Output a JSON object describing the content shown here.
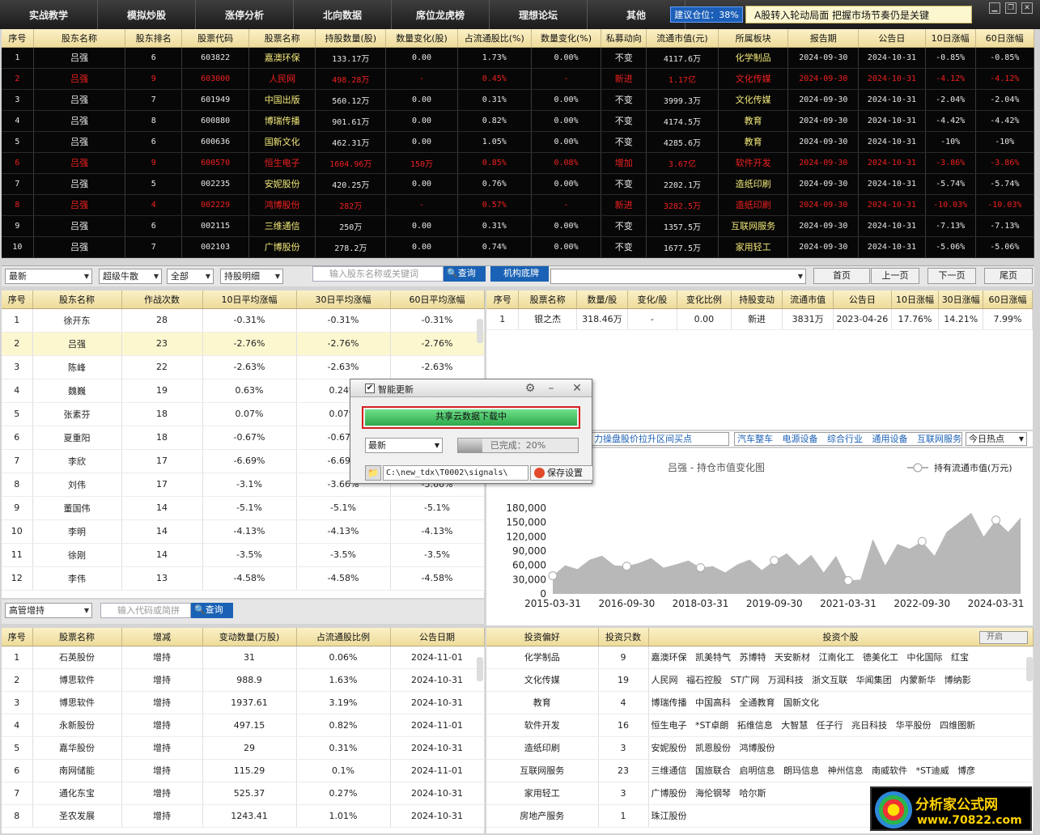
{
  "nav": {
    "items": [
      "实战教学",
      "模拟炒股",
      "涨停分析",
      "北向数据",
      "席位龙虎榜",
      "理想论坛",
      "其他"
    ],
    "advice": "建议仓位：38%",
    "marquee": "A股转入轮动局面 把握市场节奏仍是关键"
  },
  "top_table": {
    "headers": [
      "序号",
      "股东名称",
      "股东排名",
      "股票代码",
      "股票名称",
      "持股数量(股)",
      "数量变化(股)",
      "占流通股比(%)",
      "数量变化(%)",
      "私募动向",
      "流通市值(元)",
      "所属板块",
      "报告期",
      "公告日",
      "10日涨幅",
      "60日涨幅"
    ],
    "rows": [
      [
        "1",
        "吕强",
        "6",
        "603822",
        "嘉澳环保",
        "133.17万",
        "0.00",
        "1.73%",
        "0.00%",
        "不变",
        "4117.6万",
        "化学制品",
        "2024-09-30",
        "2024-10-31",
        "-0.85%",
        "-0.85%"
      ],
      [
        "2",
        "吕强",
        "9",
        "603000",
        "人民网",
        "498.28万",
        "-",
        "0.45%",
        "-",
        "新进",
        "1.17亿",
        "文化传媒",
        "2024-09-30",
        "2024-10-31",
        "-4.12%",
        "-4.12%"
      ],
      [
        "3",
        "吕强",
        "7",
        "601949",
        "中国出版",
        "560.12万",
        "0.00",
        "0.31%",
        "0.00%",
        "不变",
        "3999.3万",
        "文化传媒",
        "2024-09-30",
        "2024-10-31",
        "-2.04%",
        "-2.04%"
      ],
      [
        "4",
        "吕强",
        "8",
        "600880",
        "博瑞传播",
        "901.61万",
        "0.00",
        "0.82%",
        "0.00%",
        "不变",
        "4174.5万",
        "教育",
        "2024-09-30",
        "2024-10-31",
        "-4.42%",
        "-4.42%"
      ],
      [
        "5",
        "吕强",
        "6",
        "600636",
        "国新文化",
        "462.31万",
        "0.00",
        "1.05%",
        "0.00%",
        "不变",
        "4285.6万",
        "教育",
        "2024-09-30",
        "2024-10-31",
        "-10%",
        "-10%"
      ],
      [
        "6",
        "吕强",
        "9",
        "600570",
        "恒生电子",
        "1604.96万",
        "150万",
        "0.85%",
        "0.08%",
        "增加",
        "3.67亿",
        "软件开发",
        "2024-09-30",
        "2024-10-31",
        "-3.86%",
        "-3.86%"
      ],
      [
        "7",
        "吕强",
        "5",
        "002235",
        "安妮股份",
        "420.25万",
        "0.00",
        "0.76%",
        "0.00%",
        "不变",
        "2202.1万",
        "造纸印刷",
        "2024-09-30",
        "2024-10-31",
        "-5.74%",
        "-5.74%"
      ],
      [
        "8",
        "吕强",
        "4",
        "002229",
        "鸿博股份",
        "282万",
        "-",
        "0.57%",
        "-",
        "新进",
        "3282.5万",
        "造纸印刷",
        "2024-09-30",
        "2024-10-31",
        "-10.03%",
        "-10.03%"
      ],
      [
        "9",
        "吕强",
        "6",
        "002115",
        "三维通信",
        "250万",
        "0.00",
        "0.31%",
        "0.00%",
        "不变",
        "1357.5万",
        "互联网服务",
        "2024-09-30",
        "2024-10-31",
        "-7.13%",
        "-7.13%"
      ],
      [
        "10",
        "吕强",
        "7",
        "002103",
        "广博股份",
        "278.2万",
        "0.00",
        "0.74%",
        "0.00%",
        "不变",
        "1677.5万",
        "家用轻工",
        "2024-09-30",
        "2024-10-31",
        "-5.06%",
        "-5.06%"
      ]
    ],
    "red_rows": [
      1,
      5,
      7
    ]
  },
  "toolbar": {
    "dd1": "最新",
    "dd2": "超级牛散",
    "dd3": "全部",
    "dd4": "持股明细",
    "search_placeholder": "输入股东名称或关键词",
    "query": "查询",
    "inst": "机构底牌",
    "first": "首页",
    "prev": "上一页",
    "next": "下一页",
    "last": "尾页"
  },
  "left_table": {
    "headers": [
      "序号",
      "股东名称",
      "作战次数",
      "10日平均涨幅",
      "30日平均涨幅",
      "60日平均涨幅"
    ],
    "rows": [
      [
        "1",
        "徐开东",
        "28",
        "-0.31%",
        "-0.31%",
        "-0.31%"
      ],
      [
        "2",
        "吕强",
        "23",
        "-2.76%",
        "-2.76%",
        "-2.76%"
      ],
      [
        "3",
        "陈峰",
        "22",
        "-2.63%",
        "-2.63%",
        "-2.63%"
      ],
      [
        "4",
        "魏巍",
        "19",
        "0.63%",
        "0.24%",
        ""
      ],
      [
        "5",
        "张素芬",
        "18",
        "0.07%",
        "0.07%",
        ""
      ],
      [
        "6",
        "夏重阳",
        "18",
        "-0.67%",
        "-0.67%",
        ""
      ],
      [
        "7",
        "李欣",
        "17",
        "-6.69%",
        "-6.69%",
        ""
      ],
      [
        "8",
        "刘伟",
        "17",
        "-3.1%",
        "-3.66%",
        "-3.66%"
      ],
      [
        "9",
        "董国伟",
        "14",
        "-5.1%",
        "-5.1%",
        "-5.1%"
      ],
      [
        "10",
        "李明",
        "14",
        "-4.13%",
        "-4.13%",
        "-4.13%"
      ],
      [
        "11",
        "徐刚",
        "14",
        "-3.5%",
        "-3.5%",
        "-3.5%"
      ],
      [
        "12",
        "李伟",
        "13",
        "-4.58%",
        "-4.58%",
        "-4.58%"
      ]
    ]
  },
  "right_table": {
    "headers": [
      "序号",
      "股票名称",
      "数量/股",
      "变化/股",
      "变化比例",
      "持股变动",
      "流通市值",
      "公告日",
      "10日涨幅",
      "30日涨幅",
      "60日涨幅"
    ],
    "rows": [
      [
        "1",
        "银之杰",
        "318.46万",
        "-",
        "0.00",
        "新进",
        "3831万",
        "2023-04-26",
        "17.76%",
        "14.21%",
        "7.99%"
      ]
    ]
  },
  "dialog": {
    "check_label": "智能更新",
    "download": "共享云数据下载中",
    "select": "最新",
    "progress_text": "已完成：20%",
    "progress": 0.2,
    "path": "C:\\new_tdx\\T0002\\signals\\",
    "save": "保存设置"
  },
  "hot": {
    "a": "力操盘股价拉升区间买点",
    "b": "汽车整车 电源设备 综合行业 通用设备 互联网服务",
    "c": "今日热点"
  },
  "chart_data": {
    "type": "area",
    "title": "吕强 - 持仓市值变化图",
    "legend": "持有流通市值(万元)",
    "y_ticks": [
      "180,000",
      "150,000",
      "120,000",
      "90,000",
      "60,000",
      "30,000",
      "0"
    ],
    "x_ticks": [
      "2015-03-31",
      "2016-09-30",
      "2018-03-31",
      "2019-09-30",
      "2021-03-31",
      "2022-09-30",
      "2024-03-31"
    ],
    "ylim": [
      0,
      180000
    ],
    "x": [
      "2015-03-31",
      "2015-06-30",
      "2015-09-30",
      "2015-12-31",
      "2016-03-31",
      "2016-06-30",
      "2016-09-30",
      "2016-12-31",
      "2017-03-31",
      "2017-06-30",
      "2017-09-30",
      "2017-12-31",
      "2018-03-31",
      "2018-06-30",
      "2018-09-30",
      "2018-12-31",
      "2019-03-31",
      "2019-06-30",
      "2019-09-30",
      "2019-12-31",
      "2020-03-31",
      "2020-06-30",
      "2020-09-30",
      "2020-12-31",
      "2021-03-31",
      "2021-06-30",
      "2021-09-30",
      "2021-12-31",
      "2022-03-31",
      "2022-06-30",
      "2022-09-30",
      "2022-12-31",
      "2023-03-31",
      "2023-06-30",
      "2023-09-30",
      "2023-12-31",
      "2024-03-31",
      "2024-06-30",
      "2024-09-30"
    ],
    "values": [
      38000,
      60000,
      52000,
      72000,
      80000,
      60000,
      58000,
      65000,
      75000,
      55000,
      62000,
      70000,
      55000,
      58000,
      45000,
      62000,
      72000,
      50000,
      70000,
      85000,
      60000,
      82000,
      45000,
      80000,
      28000,
      30000,
      115000,
      60000,
      105000,
      95000,
      110000,
      80000,
      130000,
      150000,
      170000,
      120000,
      155000,
      130000,
      160000
    ],
    "markers": [
      0,
      6,
      12,
      18,
      24,
      30,
      36
    ]
  },
  "bottom_bar": {
    "dd": "高管增持",
    "placeholder": "输入代码或简拼",
    "query": "查询"
  },
  "bottom_left": {
    "headers": [
      "序号",
      "股票名称",
      "增减",
      "变动数量(万股)",
      "占流通股比例",
      "公告日期"
    ],
    "rows": [
      [
        "1",
        "石英股份",
        "增持",
        "31",
        "0.06%",
        "2024-11-01"
      ],
      [
        "2",
        "博思软件",
        "增持",
        "988.9",
        "1.63%",
        "2024-10-31"
      ],
      [
        "3",
        "博思软件",
        "增持",
        "1937.61",
        "3.19%",
        "2024-10-31"
      ],
      [
        "4",
        "永新股份",
        "增持",
        "497.15",
        "0.82%",
        "2024-11-01"
      ],
      [
        "5",
        "嘉华股份",
        "增持",
        "29",
        "0.31%",
        "2024-10-31"
      ],
      [
        "6",
        "南网储能",
        "增持",
        "115.29",
        "0.1%",
        "2024-11-01"
      ],
      [
        "7",
        "通化东宝",
        "增持",
        "525.37",
        "0.27%",
        "2024-10-31"
      ],
      [
        "8",
        "圣农发展",
        "增持",
        "1243.41",
        "1.01%",
        "2024-10-31"
      ]
    ]
  },
  "bottom_right": {
    "headers": [
      "投资偏好",
      "投资只数",
      "投资个股"
    ],
    "toggle": "开启",
    "rows": [
      [
        "化学制品",
        "9",
        "嘉澳环保 凯美特气 苏博特 天安新材 江南化工 德美化工 中化国际 红宝"
      ],
      [
        "文化传媒",
        "19",
        "人民网 福石控股 ST广网 万润科技 浙文互联 华闻集团 内蒙新华 博纳影"
      ],
      [
        "教育",
        "4",
        "博瑞传播 中国高科 全通教育 国新文化"
      ],
      [
        "软件开发",
        "16",
        "恒生电子 *ST卓朗 拓维信息 大智慧 任子行 兆日科技 华平股份 四维图新"
      ],
      [
        "造纸印刷",
        "3",
        "安妮股份 凯恩股份 鸿博股份"
      ],
      [
        "互联网服务",
        "23",
        "三维通信 国旅联合 启明信息 朗玛信息 神州信息 南威软件 *ST迪威 博彦"
      ],
      [
        "家用轻工",
        "3",
        "广博股份 海伦钢琴 哈尔斯"
      ],
      [
        "房地产服务",
        "1",
        "珠江股份"
      ]
    ]
  },
  "logo": {
    "text": "分析家公式网",
    "url": "www.70822.com"
  }
}
